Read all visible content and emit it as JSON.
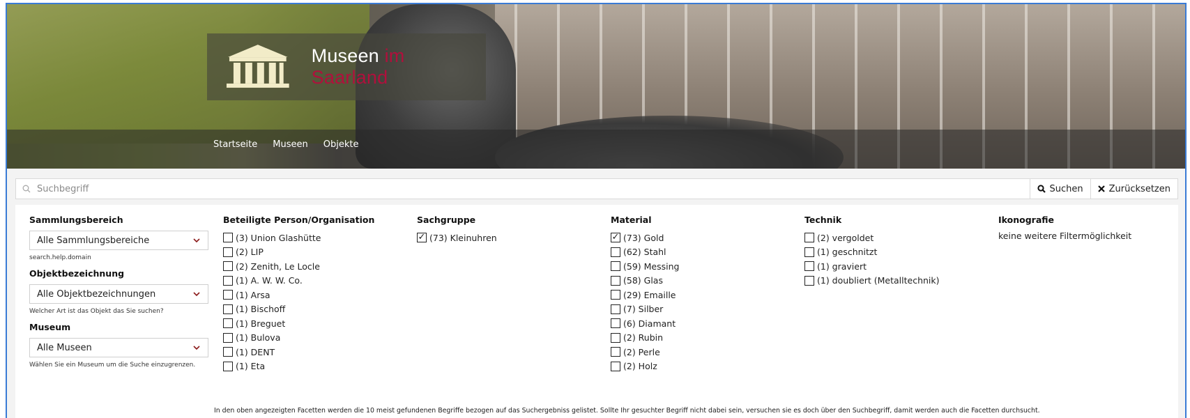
{
  "header": {
    "site_title_main": "Museen",
    "site_title_accent": "im Saarland",
    "nav": [
      "Startseite",
      "Museen",
      "Objekte"
    ]
  },
  "search": {
    "placeholder": "Suchbegriff",
    "search_label": "Suchen",
    "reset_label": "Zurücksetzen"
  },
  "filters": {
    "sammlungsbereich": {
      "title": "Sammlungsbereich",
      "selected": "Alle Sammlungsbereiche",
      "help": "search.help.domain"
    },
    "objektbezeichnung": {
      "title": "Objektbezeichnung",
      "selected": "Alle Objektbezeichnungen",
      "help": "Welcher Art ist das Objekt das Sie suchen?"
    },
    "museum": {
      "title": "Museum",
      "selected": "Alle Museen",
      "help": "Wählen Sie ein Museum um die Suche einzugrenzen."
    }
  },
  "facets": {
    "personen": {
      "title": "Beteiligte Person/Organisation",
      "items": [
        {
          "label": "(3) Union Glashütte",
          "checked": false
        },
        {
          "label": "(2) LIP",
          "checked": false
        },
        {
          "label": "(2) Zenith, Le Locle",
          "checked": false
        },
        {
          "label": "(1) A. W. W. Co.",
          "checked": false
        },
        {
          "label": "(1) Arsa",
          "checked": false
        },
        {
          "label": "(1) Bischoff",
          "checked": false
        },
        {
          "label": "(1) Breguet",
          "checked": false
        },
        {
          "label": "(1) Bulova",
          "checked": false
        },
        {
          "label": "(1) DENT",
          "checked": false
        },
        {
          "label": "(1) Eta",
          "checked": false
        }
      ]
    },
    "sachgruppe": {
      "title": "Sachgruppe",
      "items": [
        {
          "label": "(73) Kleinuhren",
          "checked": true
        }
      ]
    },
    "material": {
      "title": "Material",
      "items": [
        {
          "label": "(73) Gold",
          "checked": true
        },
        {
          "label": "(62) Stahl",
          "checked": false
        },
        {
          "label": "(59) Messing",
          "checked": false
        },
        {
          "label": "(58) Glas",
          "checked": false
        },
        {
          "label": "(29) Emaille",
          "checked": false
        },
        {
          "label": "(7) Silber",
          "checked": false
        },
        {
          "label": "(6) Diamant",
          "checked": false
        },
        {
          "label": "(2) Rubin",
          "checked": false
        },
        {
          "label": "(2) Perle",
          "checked": false
        },
        {
          "label": "(2) Holz",
          "checked": false
        }
      ]
    },
    "technik": {
      "title": "Technik",
      "items": [
        {
          "label": "(2) vergoldet",
          "checked": false
        },
        {
          "label": "(1) geschnitzt",
          "checked": false
        },
        {
          "label": "(1) graviert",
          "checked": false
        },
        {
          "label": "(1) doubliert (Metalltechnik)",
          "checked": false
        }
      ]
    },
    "ikonografie": {
      "title": "Ikonografie",
      "empty_text": "keine weitere Filtermöglichkeit"
    }
  },
  "footer_note": "In den oben angezeigten Facetten werden die 10 meist gefundenen Begriffe bezogen auf das Suchergebniss gelistet. Sollte Ihr gesuchter Begriff nicht dabei sein, versuchen sie es doch über den Suchbegriff, damit werden auch die Facetten durchsucht.",
  "colors": {
    "accent": "#b0103c",
    "frame_border": "#3a7bd5",
    "logo_icon": "#f2ecc8"
  }
}
